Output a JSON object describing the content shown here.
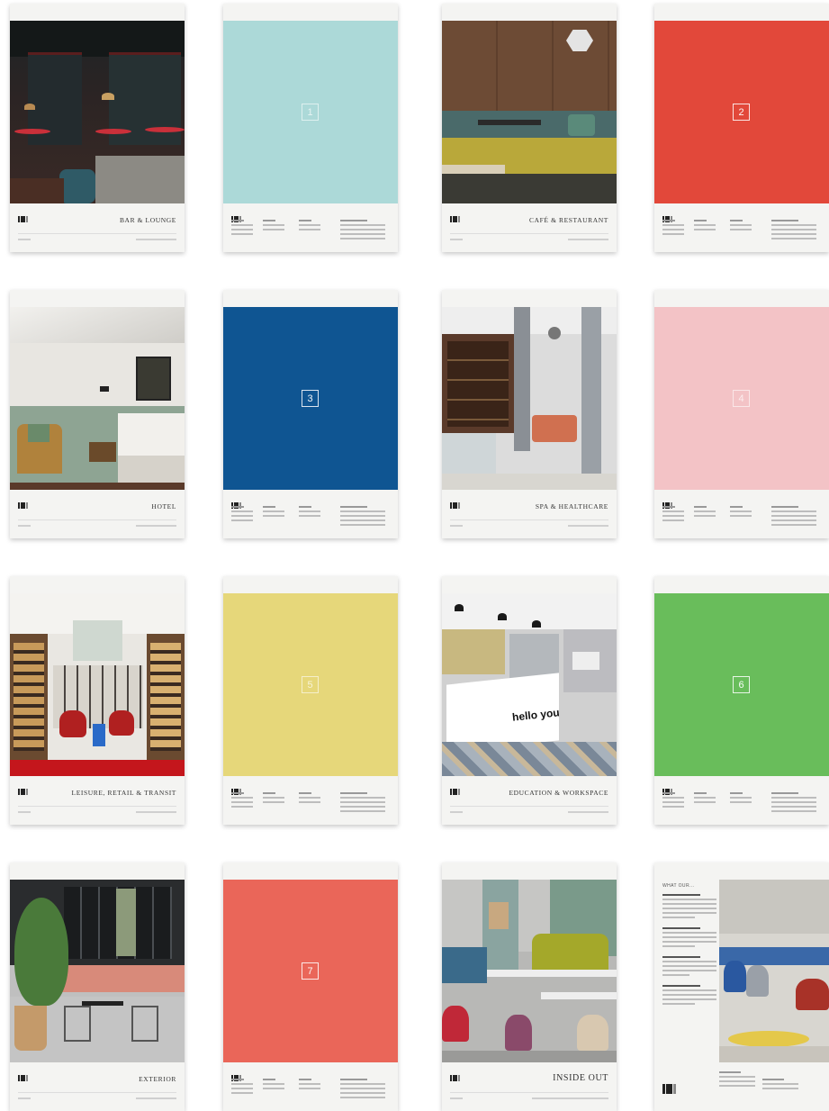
{
  "cards": [
    {
      "type": "photo",
      "title": "BAR & LOUNGE"
    },
    {
      "type": "swatch",
      "number": "1",
      "color": "#acd9d8"
    },
    {
      "type": "photo",
      "title": "CAFÉ & RESTAURANT"
    },
    {
      "type": "swatch",
      "number": "2",
      "color": "#e2483a"
    },
    {
      "type": "photo",
      "title": "HOTEL"
    },
    {
      "type": "swatch",
      "number": "3",
      "color": "#0f5592"
    },
    {
      "type": "photo",
      "title": "SPA & HEALTHCARE"
    },
    {
      "type": "swatch",
      "number": "4",
      "color": "#f3c3c6"
    },
    {
      "type": "photo",
      "title": "LEISURE, RETAIL & TRANSIT"
    },
    {
      "type": "swatch",
      "number": "5",
      "color": "#e6d77a"
    },
    {
      "type": "photo",
      "title": "EDUCATION & WORKSPACE",
      "sign_text": "hello you"
    },
    {
      "type": "swatch",
      "number": "6",
      "color": "#69bd5b"
    },
    {
      "type": "photo",
      "title": "EXTERIOR"
    },
    {
      "type": "swatch",
      "number": "7",
      "color": "#ea6659"
    },
    {
      "type": "photo",
      "title": "INSIDE OUT"
    },
    {
      "type": "testimonials",
      "heading": "WHAT OUR..."
    }
  ]
}
